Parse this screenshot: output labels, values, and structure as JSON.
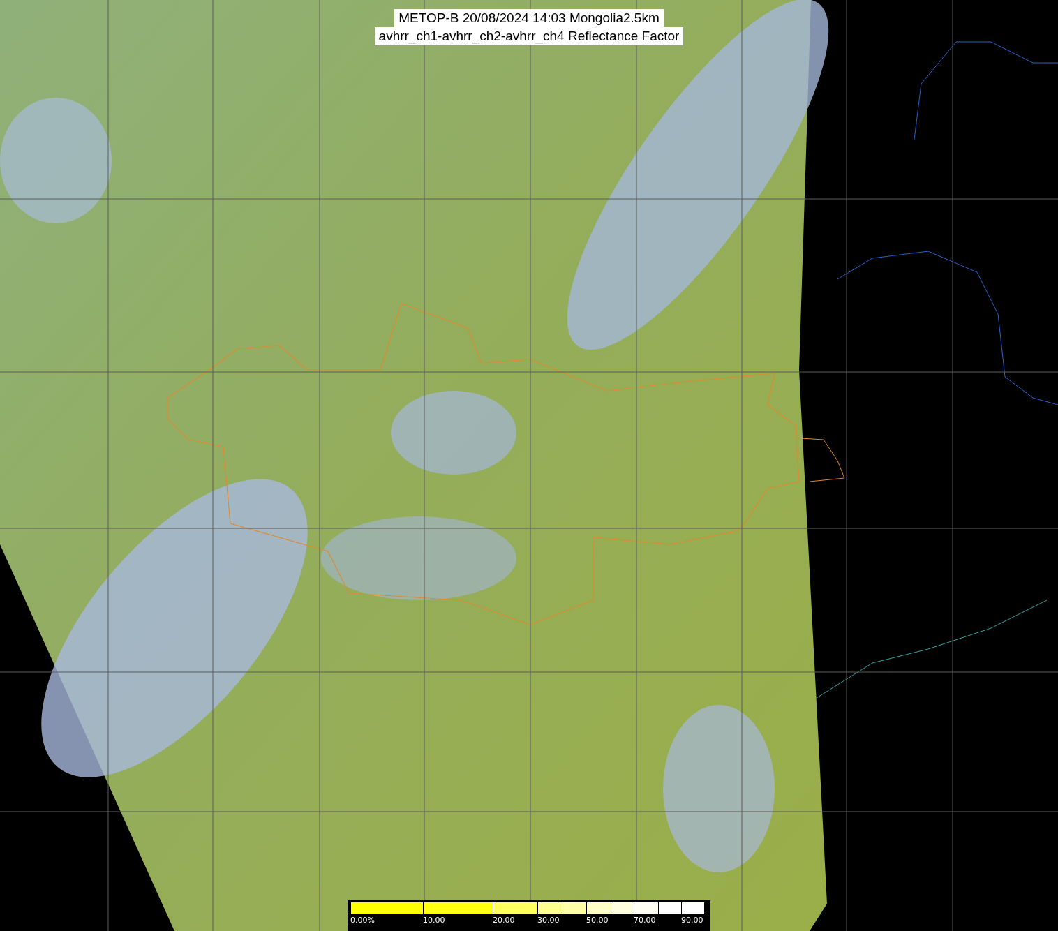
{
  "title": {
    "lines": [
      "METOP-B 20/08/2024 14:03 Mongolia2.5km",
      "avhrr_ch1-avhrr_ch2-avhrr_ch4 Reflectance Factor"
    ]
  },
  "colorbar": {
    "labels": [
      "0.00%",
      "10.00",
      "20.00",
      "30.00",
      "50.00",
      "70.00",
      "90.00"
    ]
  }
}
